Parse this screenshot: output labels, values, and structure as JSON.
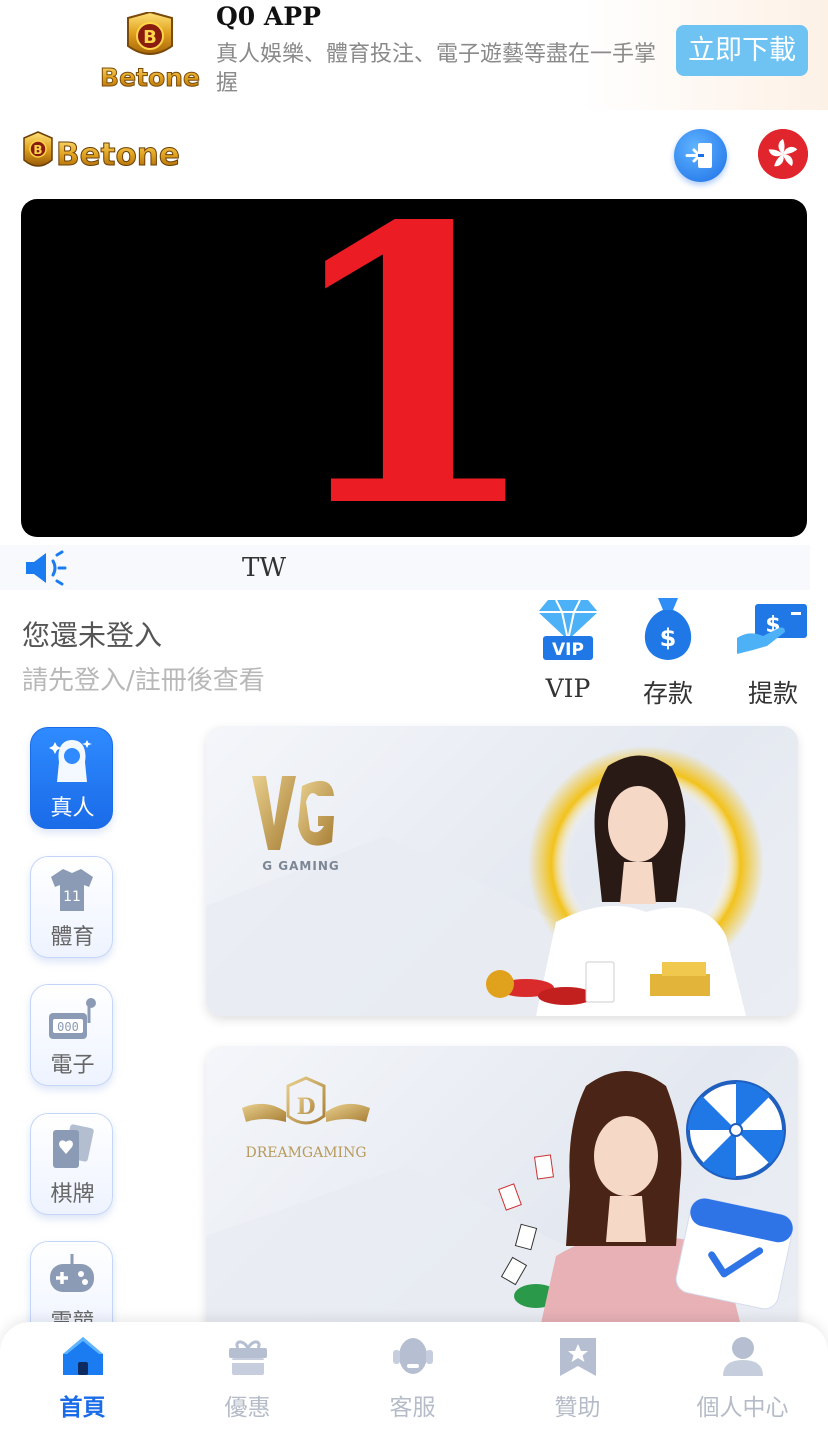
{
  "app_banner": {
    "logo_text": "Betone",
    "title": "Q0 APP",
    "description": "真人娛樂、體育投注、電子遊藝等盡在一手掌握",
    "download_label": "立即下載"
  },
  "header": {
    "logo_text": "Betone",
    "login_icon": "login-icon",
    "language_icon": "hong-kong-flag-icon"
  },
  "hero": {
    "display_text": "1"
  },
  "marquee": {
    "icon": "speaker-icon",
    "text": "TW"
  },
  "login_prompt": {
    "title": "您還未登入",
    "subtitle": "請先登入/註冊後查看"
  },
  "quick_actions": [
    {
      "label": "VIP",
      "icon": "vip-diamond-icon"
    },
    {
      "label": "存款",
      "icon": "money-bag-icon"
    },
    {
      "label": "提款",
      "icon": "withdraw-icon"
    }
  ],
  "categories": [
    {
      "label": "真人",
      "icon": "live-casino-icon",
      "active": true
    },
    {
      "label": "體育",
      "icon": "jersey-icon",
      "active": false
    },
    {
      "label": "電子",
      "icon": "slot-machine-icon",
      "active": false
    },
    {
      "label": "棋牌",
      "icon": "playing-cards-icon",
      "active": false
    },
    {
      "label": "電競",
      "icon": "gamepad-icon",
      "active": false
    }
  ],
  "game_cards": [
    {
      "provider_logo_text": "G GAMING"
    },
    {
      "provider_logo_text": "DREAMGAMING"
    }
  ],
  "bottom_nav": [
    {
      "label": "首頁",
      "icon": "home-icon",
      "active": true
    },
    {
      "label": "優惠",
      "icon": "gift-icon",
      "active": false
    },
    {
      "label": "客服",
      "icon": "customer-service-icon",
      "active": false
    },
    {
      "label": "贊助",
      "icon": "sponsor-icon",
      "active": false
    },
    {
      "label": "個人中心",
      "icon": "user-icon",
      "active": false
    }
  ],
  "colors": {
    "accent": "#1a6be8",
    "download_button": "#6ec3f2",
    "hero_digit": "#ec1c24",
    "nav_inactive": "#b5bcc8"
  }
}
